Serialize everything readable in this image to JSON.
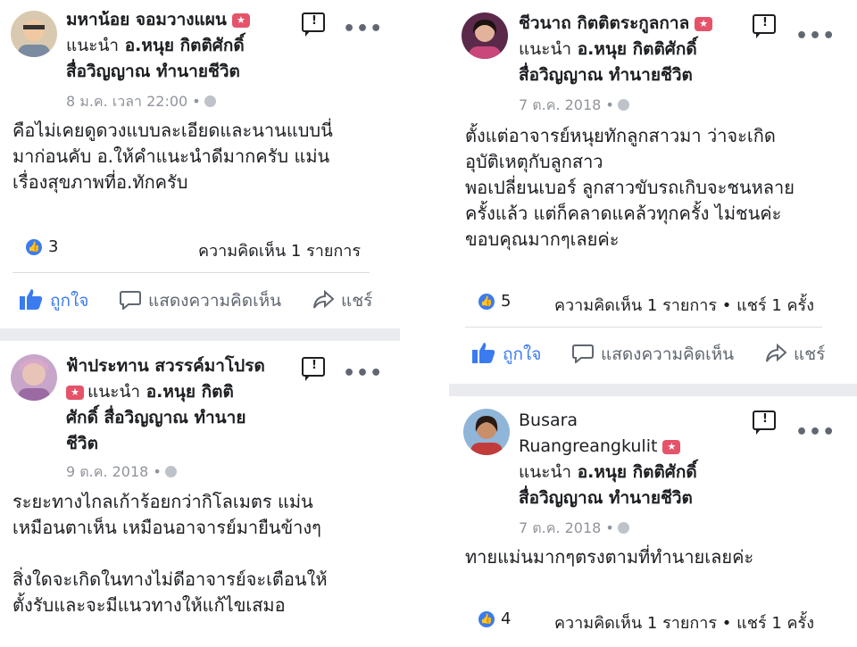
{
  "colors": {
    "brand_blue": "#3b7bf0",
    "badge_red": "#e5536a",
    "separator": "#e9ebee"
  },
  "posts": [
    {
      "author": "มหาน้อย จอมวางแผน",
      "recommend": "แนะนำ",
      "page_line1": "อ.หนุย กิตติศักดิ์",
      "page_line2": "สื่อวิญญาณ ทำนายชีวิต",
      "date": "8 ม.ค. เวลา 22:00 •",
      "text": "คือไม่เคยดูดวงแบบละเอียดและนานแบบนี่\nมาก่อนคับ อ.ให้คำแนะนำดีมากครับ แม่น\nเรื่องสุขภาพที่อ.ทักครับ",
      "likes": "3",
      "stats": "ความคิดเห็น 1 รายการ",
      "actions": {
        "like": "ถูกใจ",
        "comment": "แสดงความคิดเห็น",
        "share": "แชร์"
      }
    },
    {
      "author": "ฟ้าประทาน สวรรค์มาโปรด",
      "recommend": "แนะนำ",
      "page_line1": "อ.หนุย กิตติ",
      "page_line2": "ศักดิ์ สื่อวิญญาณ ทำนาย",
      "page_line3": "ชีวิต",
      "date": "9 ต.ค. 2018 •",
      "text": "ระยะทางไกลเก้าร้อยกว่ากิโลเมตร แม่น\nเหมือนตาเห็น เหมือนอาจารย์มายืนข้างๆ\n\nสิ่งใดจะเกิดในทางไม่ดีอาจารย์จะเตือนให้\nตั้งรับและจะมีแนวทางให้แก้ไขเสมอ"
    },
    {
      "author": "ชีวนาถ กิตติตระกูลกาล",
      "recommend": "แนะนำ",
      "page_line1": "อ.หนุย กิตติศักดิ์",
      "page_line2": "สื่อวิญญาณ ทำนายชีวิต",
      "date": "7 ต.ค. 2018 •",
      "text": "ตั้งแต่อาจารย์หนุยทักลูกสาวมา ว่าจะเกิด\nอุบัติเหตุกับลูกสาว\nพอเปลี่ยนเบอร์ ลูกสาวขับรถเกิบจะชนหลาย\nครั้งแล้ว แต่ก็คลาดแคล้วทุกครั้ง ไม่ชนค่ะ\nขอบคุณมากๆเลยค่ะ",
      "likes": "5",
      "stats": "ความคิดเห็น 1 รายการ • แชร์ 1 ครั้ง",
      "actions": {
        "like": "ถูกใจ",
        "comment": "แสดงความคิดเห็น",
        "share": "แชร์"
      }
    },
    {
      "author_line1": "Busara",
      "author_line2": "Ruangreangkulit",
      "recommend": "แนะนำ",
      "page_line1": "อ.หนุย กิตติศักดิ์",
      "page_line2": "สื่อวิญญาณ ทำนายชีวิต",
      "date": "7 ต.ค. 2018 •",
      "text": "ทายแม่นมากๆตรงตามที่ทำนายเลยค่ะ",
      "likes": "4",
      "stats": "ความคิดเห็น 1 รายการ • แชร์ 1 ครั้ง"
    }
  ]
}
